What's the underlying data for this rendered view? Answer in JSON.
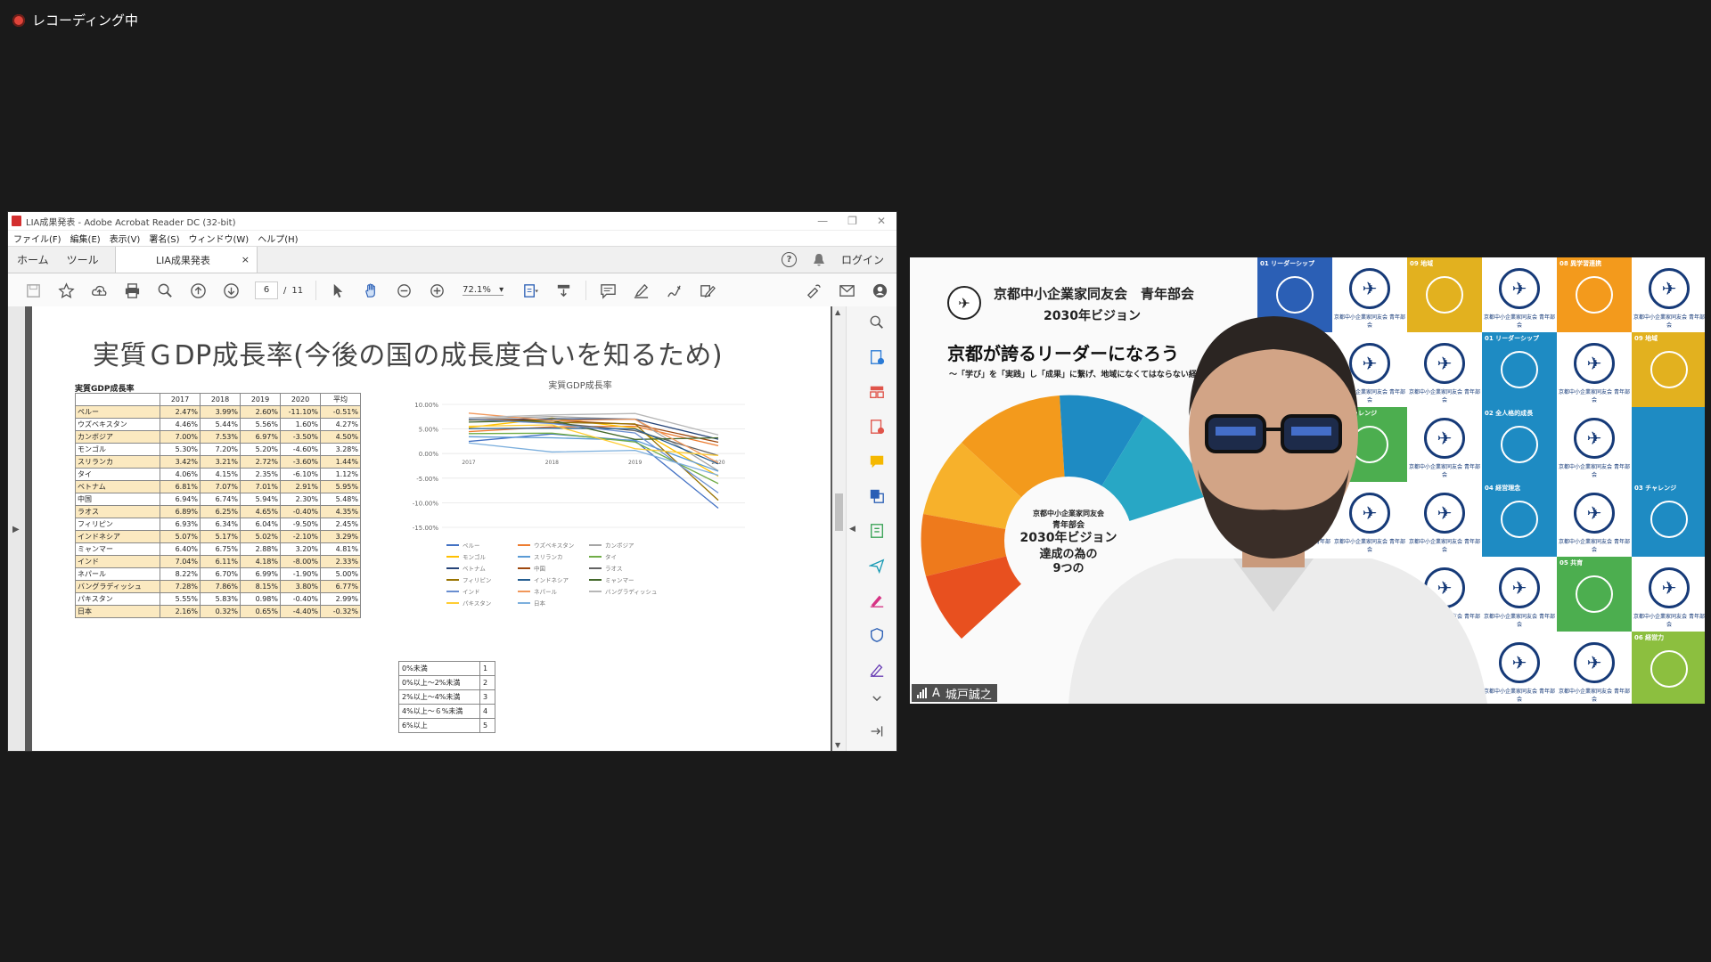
{
  "recording": {
    "label": "レコーディング中"
  },
  "acrobat": {
    "title": "LIA成果発表 - Adobe Acrobat Reader DC (32-bit)",
    "menu": [
      "ファイル(F)",
      "編集(E)",
      "表示(V)",
      "署名(S)",
      "ウィンドウ(W)",
      "ヘルプ(H)"
    ],
    "tabs": {
      "home": "ホーム",
      "tools": "ツール",
      "doc": "LIA成果発表",
      "close": "×",
      "login": "ログイン"
    },
    "page_current": "6",
    "page_sep": "/",
    "page_total": "11",
    "zoom": "72.1%"
  },
  "slide": {
    "title": "実質ＧDP成長率(今後の国の成長度合いを知るため)",
    "table_caption": "実質GDP成長率",
    "headers": [
      "",
      "2017",
      "2018",
      "2019",
      "2020",
      "平均"
    ],
    "rows": [
      [
        "ペルー",
        "2.47%",
        "3.99%",
        "2.60%",
        "-11.10%",
        "-0.51%"
      ],
      [
        "ウズベキスタン",
        "4.46%",
        "5.44%",
        "5.56%",
        "1.60%",
        "4.27%"
      ],
      [
        "カンボジア",
        "7.00%",
        "7.53%",
        "6.97%",
        "-3.50%",
        "4.50%"
      ],
      [
        "モンゴル",
        "5.30%",
        "7.20%",
        "5.20%",
        "-4.60%",
        "3.28%"
      ],
      [
        "スリランカ",
        "3.42%",
        "3.21%",
        "2.72%",
        "-3.60%",
        "1.44%"
      ],
      [
        "タイ",
        "4.06%",
        "4.15%",
        "2.35%",
        "-6.10%",
        "1.12%"
      ],
      [
        "ベトナム",
        "6.81%",
        "7.07%",
        "7.01%",
        "2.91%",
        "5.95%"
      ],
      [
        "中国",
        "6.94%",
        "6.74%",
        "5.94%",
        "2.30%",
        "5.48%"
      ],
      [
        "ラオス",
        "6.89%",
        "6.25%",
        "4.65%",
        "-0.40%",
        "4.35%"
      ],
      [
        "フィリピン",
        "6.93%",
        "6.34%",
        "6.04%",
        "-9.50%",
        "2.45%"
      ],
      [
        "インドネシア",
        "5.07%",
        "5.17%",
        "5.02%",
        "-2.10%",
        "3.29%"
      ],
      [
        "ミャンマー",
        "6.40%",
        "6.75%",
        "2.88%",
        "3.20%",
        "4.81%"
      ],
      [
        "インド",
        "7.04%",
        "6.11%",
        "4.18%",
        "-8.00%",
        "2.33%"
      ],
      [
        "ネパール",
        "8.22%",
        "6.70%",
        "6.99%",
        "-1.90%",
        "5.00%"
      ],
      [
        "バングラディッシュ",
        "7.28%",
        "7.86%",
        "8.15%",
        "3.80%",
        "6.77%"
      ],
      [
        "パキスタン",
        "5.55%",
        "5.83%",
        "0.98%",
        "-0.40%",
        "2.99%"
      ],
      [
        "日本",
        "2.16%",
        "0.32%",
        "0.65%",
        "-4.40%",
        "-0.32%"
      ]
    ],
    "row_highlight": [
      true,
      false,
      true,
      false,
      true,
      false,
      true,
      false,
      true,
      false,
      true,
      false,
      true,
      false,
      true,
      false,
      true
    ],
    "score_table": [
      [
        "0%未満",
        "1"
      ],
      [
        "0%以上～2%未満",
        "2"
      ],
      [
        "2%以上～4%未満",
        "3"
      ],
      [
        "4%以上～６%未満",
        "4"
      ],
      [
        "6%以上",
        "5"
      ]
    ]
  },
  "chart_data": {
    "type": "line",
    "title": "実質GDP成長率",
    "x": [
      "2017",
      "2018",
      "2019",
      "2020"
    ],
    "ylim": [
      -15,
      10
    ],
    "yticks": [
      "10.00%",
      "5.00%",
      "0.00%",
      "-5.00%",
      "-10.00%",
      "-15.00%"
    ],
    "series": [
      {
        "name": "ペルー",
        "values": [
          2.47,
          3.99,
          2.6,
          -11.1
        ],
        "color": "#4472c4"
      },
      {
        "name": "ウズベキスタン",
        "values": [
          4.46,
          5.44,
          5.56,
          1.6
        ],
        "color": "#ed7d31"
      },
      {
        "name": "カンボジア",
        "values": [
          7.0,
          7.53,
          6.97,
          -3.5
        ],
        "color": "#a5a5a5"
      },
      {
        "name": "モンゴル",
        "values": [
          5.3,
          7.2,
          5.2,
          -4.6
        ],
        "color": "#ffc000"
      },
      {
        "name": "スリランカ",
        "values": [
          3.42,
          3.21,
          2.72,
          -3.6
        ],
        "color": "#5b9bd5"
      },
      {
        "name": "タイ",
        "values": [
          4.06,
          4.15,
          2.35,
          -6.1
        ],
        "color": "#70ad47"
      },
      {
        "name": "ベトナム",
        "values": [
          6.81,
          7.07,
          7.01,
          2.91
        ],
        "color": "#264478"
      },
      {
        "name": "中国",
        "values": [
          6.94,
          6.74,
          5.94,
          2.3
        ],
        "color": "#9e480e"
      },
      {
        "name": "ラオス",
        "values": [
          6.89,
          6.25,
          4.65,
          -0.4
        ],
        "color": "#636363"
      },
      {
        "name": "フィリピン",
        "values": [
          6.93,
          6.34,
          6.04,
          -9.5
        ],
        "color": "#997300"
      },
      {
        "name": "インドネシア",
        "values": [
          5.07,
          5.17,
          5.02,
          -2.1
        ],
        "color": "#255e91"
      },
      {
        "name": "ミャンマー",
        "values": [
          6.4,
          6.75,
          2.88,
          3.2
        ],
        "color": "#43682b"
      },
      {
        "name": "インド",
        "values": [
          7.04,
          6.11,
          4.18,
          -8.0
        ],
        "color": "#698ed0"
      },
      {
        "name": "ネパール",
        "values": [
          8.22,
          6.7,
          6.99,
          -1.9
        ],
        "color": "#f1975a"
      },
      {
        "name": "バングラディッシュ",
        "values": [
          7.28,
          7.86,
          8.15,
          3.8
        ],
        "color": "#b7b7b7"
      },
      {
        "name": "パキスタン",
        "values": [
          5.55,
          5.83,
          0.98,
          -0.4
        ],
        "color": "#ffcd33"
      },
      {
        "name": "日本",
        "values": [
          2.16,
          0.32,
          0.65,
          -4.4
        ],
        "color": "#7cafdd"
      }
    ]
  },
  "video": {
    "participant_name": "城戸誠之",
    "audio_flag": "A",
    "vision_org": "京都中小企業家同友会　青年部会",
    "vision_year": "2030年ビジョン",
    "vision_lead": "京都が誇るリーダーになろう",
    "vision_sub": "～「学び」を「実践」し「成果」に繋げ、地域になくてはならない経営者へ",
    "circle_center": [
      "京都中小企業家同友会",
      "青年部会",
      "2030年ビジョン",
      "達成の為の",
      "9つの"
    ],
    "grid_labels": [
      "01 リーダーシップ",
      "09 地域",
      "08 異学習連携",
      "09 地域",
      "01 リーダーシップ",
      "03 チャレンジ",
      "02 全人格的成長",
      "04 経営理念",
      "03 チャレンジ",
      "05 共育",
      "06 経営力"
    ],
    "tile_caption": "京都中小企業家同友会 青年部会"
  }
}
